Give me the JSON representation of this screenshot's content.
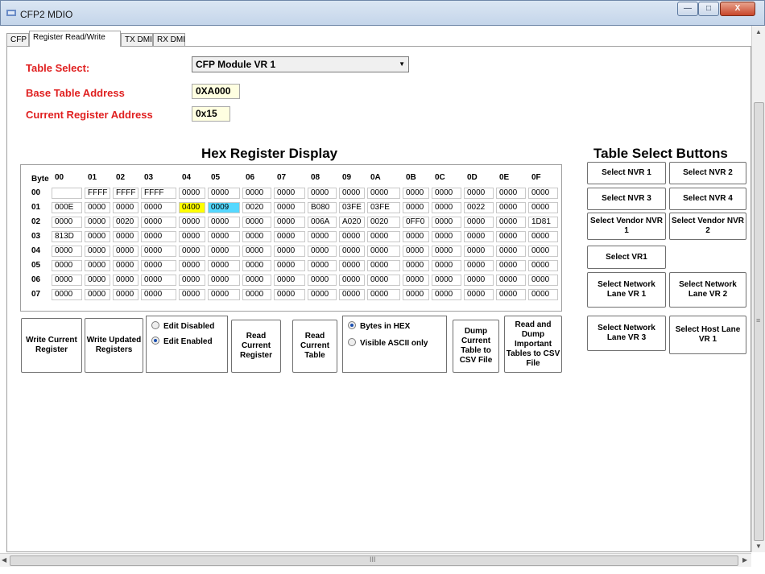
{
  "window": {
    "title": "CFP2 MDIO",
    "min": "—",
    "max": "□",
    "close": "X"
  },
  "tabs": [
    "CFP",
    "Register Read/Write",
    "TX DMI",
    "RX DMI"
  ],
  "form": {
    "table_select_label": "Table Select:",
    "table_select_value": "CFP Module VR 1",
    "base_label": "Base Table Address",
    "base_value": "0XA000",
    "current_label": "Current Register Address",
    "current_value": "0x15"
  },
  "hex": {
    "title": "Hex Register Display",
    "byte_label": "Byte",
    "columns": [
      "00",
      "01",
      "02",
      "03",
      "04",
      "05",
      "06",
      "07",
      "08",
      "09",
      "0A",
      "0B",
      "0C",
      "0D",
      "0E",
      "0F"
    ],
    "rows": [
      {
        "label": "00",
        "cells": [
          "",
          "FFFF",
          "FFFF",
          "FFFF",
          "0000",
          "0000",
          "0000",
          "0000",
          "0000",
          "0000",
          "0000",
          "0000",
          "0000",
          "0000",
          "0000",
          "0000"
        ]
      },
      {
        "label": "01",
        "cells": [
          "000E",
          "0000",
          "0000",
          "0000",
          "0400",
          "0009",
          "0020",
          "0000",
          "B080",
          "03FE",
          "03FE",
          "0000",
          "0000",
          "0022",
          "0000",
          "0000"
        ]
      },
      {
        "label": "02",
        "cells": [
          "0000",
          "0000",
          "0020",
          "0000",
          "0000",
          "0000",
          "0000",
          "0000",
          "006A",
          "A020",
          "0020",
          "0FF0",
          "0000",
          "0000",
          "0000",
          "1D81"
        ]
      },
      {
        "label": "03",
        "cells": [
          "813D",
          "0000",
          "0000",
          "0000",
          "0000",
          "0000",
          "0000",
          "0000",
          "0000",
          "0000",
          "0000",
          "0000",
          "0000",
          "0000",
          "0000",
          "0000"
        ]
      },
      {
        "label": "04",
        "cells": [
          "0000",
          "0000",
          "0000",
          "0000",
          "0000",
          "0000",
          "0000",
          "0000",
          "0000",
          "0000",
          "0000",
          "0000",
          "0000",
          "0000",
          "0000",
          "0000"
        ]
      },
      {
        "label": "05",
        "cells": [
          "0000",
          "0000",
          "0000",
          "0000",
          "0000",
          "0000",
          "0000",
          "0000",
          "0000",
          "0000",
          "0000",
          "0000",
          "0000",
          "0000",
          "0000",
          "0000"
        ]
      },
      {
        "label": "06",
        "cells": [
          "0000",
          "0000",
          "0000",
          "0000",
          "0000",
          "0000",
          "0000",
          "0000",
          "0000",
          "0000",
          "0000",
          "0000",
          "0000",
          "0000",
          "0000",
          "0000"
        ]
      },
      {
        "label": "07",
        "cells": [
          "0000",
          "0000",
          "0000",
          "0000",
          "0000",
          "0000",
          "0000",
          "0000",
          "0000",
          "0000",
          "0000",
          "0000",
          "0000",
          "0000",
          "0000",
          "0000"
        ]
      }
    ],
    "highlight_yellow": "#ffff00",
    "highlight_blue": "#55d8ff"
  },
  "actions": {
    "write_current": "Write Current Register",
    "write_updated": "Write Updated Registers",
    "edit_disabled": "Edit Disabled",
    "edit_enabled": "Edit Enabled",
    "read_current_register": "Read Current Register",
    "read_current_table": "Read Current Table",
    "bytes_hex": "Bytes in HEX",
    "visible_ascii": "Visible ASCII only",
    "dump_current": "Dump Current Table to CSV File",
    "read_dump": "Read and Dump Important Tables to CSV File"
  },
  "table_buttons": {
    "title": "Table Select Buttons",
    "nvr1": "Select NVR 1",
    "nvr2": "Select NVR 2",
    "nvr3": "Select NVR 3",
    "nvr4": "Select NVR 4",
    "vendor1": "Select Vendor NVR 1",
    "vendor2": "Select Vendor NVR 2",
    "vr1": "Select VR1",
    "net1": "Select Network Lane VR 1",
    "net2": "Select Network Lane VR 2",
    "net3": "Select Network Lane VR 3",
    "host1": "Select Host Lane VR 1"
  },
  "scroll": {
    "h_grip": "III",
    "v_grip": "≡"
  },
  "colors": {
    "label_red": "#e02020",
    "field_yellow": "#ffffe1"
  }
}
